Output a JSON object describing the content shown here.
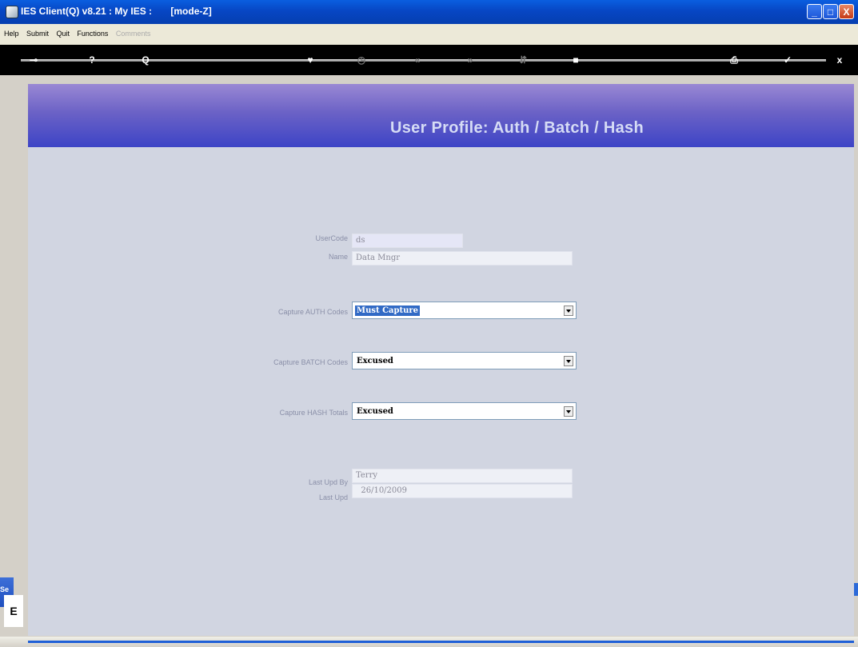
{
  "window": {
    "title": "IES Client(Q) v8.21 : My IES :       [mode-Z]",
    "min_symbol": "_",
    "max_symbol": "□",
    "close_symbol": "X"
  },
  "menu": {
    "items": [
      "Help",
      "Submit",
      "Quit",
      "Functions"
    ],
    "disabled_item": "Comments"
  },
  "toolbar": {
    "icons": [
      "key-icon",
      "help-icon",
      "search-icon",
      "heart-icon",
      "clock-icon",
      "prev-icon",
      "next-icon",
      "sort-icon",
      "stop-icon",
      "print-icon",
      "ok-icon",
      "cancel-icon"
    ],
    "glyphs": {
      "key": "⊸",
      "help": "?",
      "search": "Q",
      "heart": "♥",
      "clock": "◷",
      "prev": "«",
      "next": "»",
      "sort": "⇵",
      "stop": "■",
      "print": "⎙",
      "ok": "✓",
      "cancel": "x"
    }
  },
  "header": {
    "title": "User Profile: Auth / Batch / Hash"
  },
  "form": {
    "usercode_label": "UserCode",
    "usercode_value": "ds",
    "name_label": "Name",
    "name_value": "Data Mngr",
    "auth_label": "Capture AUTH Codes",
    "auth_value": "Must Capture",
    "batch_label": "Capture BATCH Codes",
    "batch_value": "Excused",
    "hash_label": "Capture HASH Totals",
    "hash_value": "Excused",
    "lastupdby_label": "Last Upd By",
    "lastupdby_value": "Terry",
    "lastupd_label": "Last Upd",
    "lastupd_value": "  26/10/2009"
  },
  "side": {
    "tab_label": "Se",
    "box_label": "E"
  },
  "colors": {
    "header_top": "#9a88d4",
    "header_bottom": "#3d44c6",
    "body_bg": "#d1d5e1",
    "select_highlight": "#316ac5"
  }
}
